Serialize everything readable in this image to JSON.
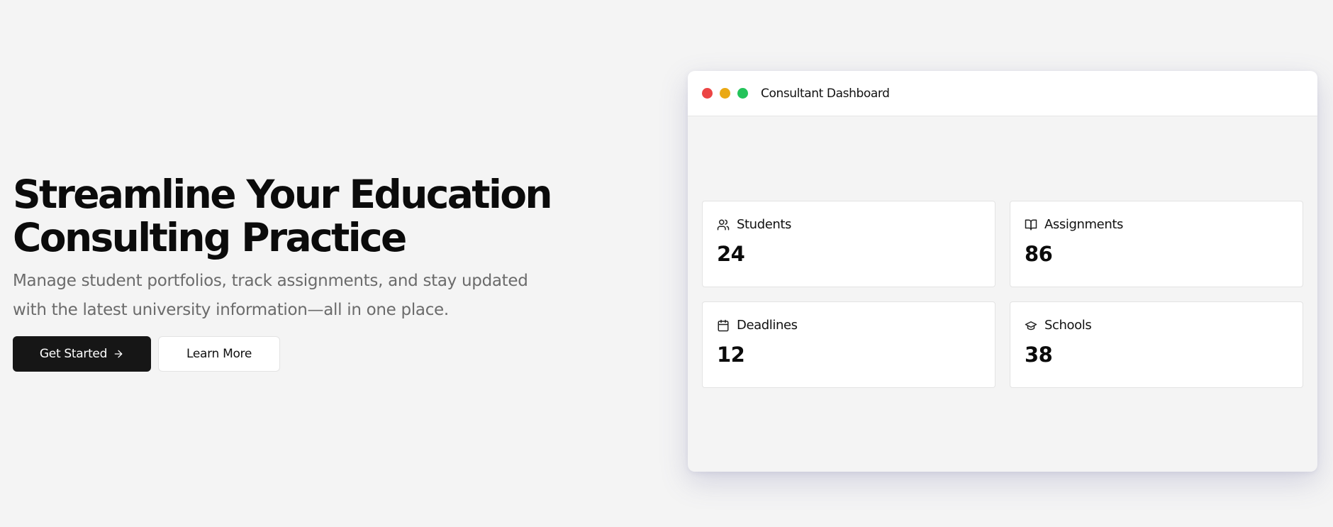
{
  "hero": {
    "title_line1": "Streamline Your Education",
    "title_line2": "Consulting Practice",
    "subtitle": "Manage student portfolios, track assignments, and stay updated with the latest university information—all in one place.",
    "primary_button": "Get Started",
    "secondary_button": "Learn More"
  },
  "dashboard": {
    "window_title": "Consultant Dashboard",
    "window_dots": [
      "#ec4444",
      "#eaa914",
      "#23c35a"
    ],
    "stats": [
      {
        "label": "Students",
        "value": "24",
        "icon": "users-icon"
      },
      {
        "label": "Assignments",
        "value": "86",
        "icon": "book-open-icon"
      },
      {
        "label": "Deadlines",
        "value": "12",
        "icon": "calendar-icon"
      },
      {
        "label": "Schools",
        "value": "38",
        "icon": "graduation-cap-icon"
      }
    ]
  },
  "colors": {
    "background": "#f4f4f4",
    "primary_button_bg": "#161616",
    "muted_text": "#6b6b6b"
  }
}
